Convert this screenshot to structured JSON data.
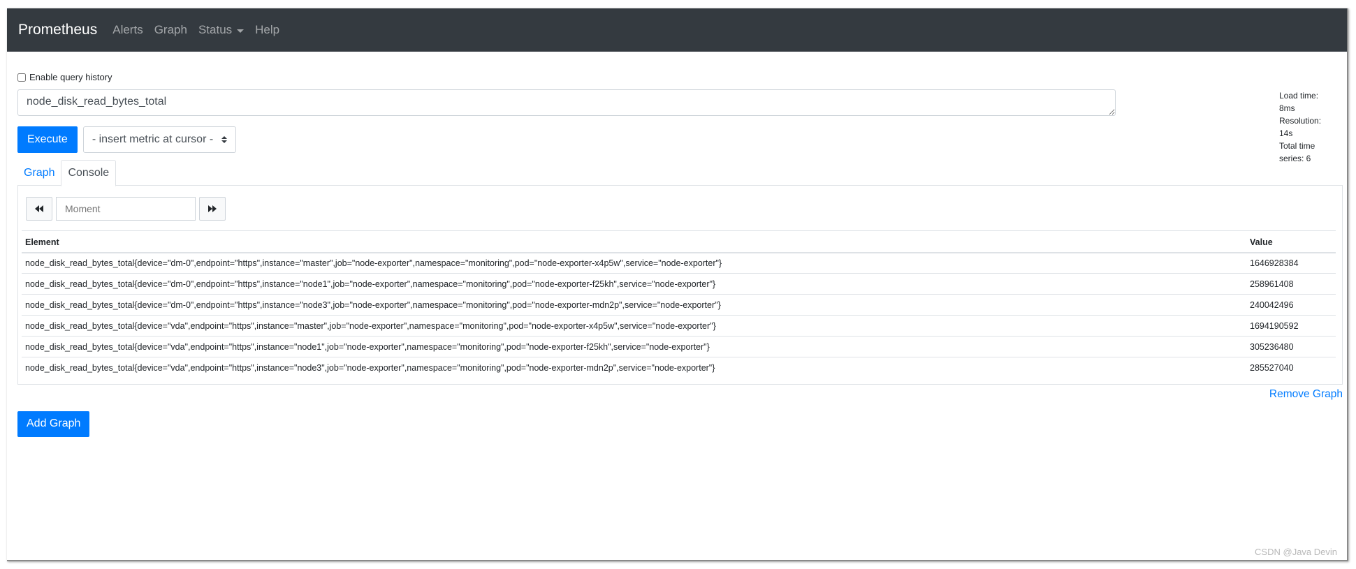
{
  "navbar": {
    "brand": "Prometheus",
    "items": [
      "Alerts",
      "Graph",
      "Status",
      "Help"
    ]
  },
  "history": {
    "label": "Enable query history",
    "checked": false
  },
  "query": {
    "value": "node_disk_read_bytes_total"
  },
  "stats": {
    "load_time": "Load time: 8ms",
    "resolution": "Resolution: 14s",
    "total_series": "Total time series: 6"
  },
  "execute_label": "Execute",
  "insert_metric": "- insert metric at cursor -",
  "tabs": [
    {
      "label": "Graph",
      "active": false
    },
    {
      "label": "Console",
      "active": true
    }
  ],
  "moment": {
    "placeholder": "Moment"
  },
  "table": {
    "headers": {
      "element": "Element",
      "value": "Value"
    },
    "rows": [
      {
        "element": "node_disk_read_bytes_total{device=\"dm-0\",endpoint=\"https\",instance=\"master\",job=\"node-exporter\",namespace=\"monitoring\",pod=\"node-exporter-x4p5w\",service=\"node-exporter\"}",
        "value": "1646928384"
      },
      {
        "element": "node_disk_read_bytes_total{device=\"dm-0\",endpoint=\"https\",instance=\"node1\",job=\"node-exporter\",namespace=\"monitoring\",pod=\"node-exporter-f25kh\",service=\"node-exporter\"}",
        "value": "258961408"
      },
      {
        "element": "node_disk_read_bytes_total{device=\"dm-0\",endpoint=\"https\",instance=\"node3\",job=\"node-exporter\",namespace=\"monitoring\",pod=\"node-exporter-mdn2p\",service=\"node-exporter\"}",
        "value": "240042496"
      },
      {
        "element": "node_disk_read_bytes_total{device=\"vda\",endpoint=\"https\",instance=\"master\",job=\"node-exporter\",namespace=\"monitoring\",pod=\"node-exporter-x4p5w\",service=\"node-exporter\"}",
        "value": "1694190592"
      },
      {
        "element": "node_disk_read_bytes_total{device=\"vda\",endpoint=\"https\",instance=\"node1\",job=\"node-exporter\",namespace=\"monitoring\",pod=\"node-exporter-f25kh\",service=\"node-exporter\"}",
        "value": "305236480"
      },
      {
        "element": "node_disk_read_bytes_total{device=\"vda\",endpoint=\"https\",instance=\"node3\",job=\"node-exporter\",namespace=\"monitoring\",pod=\"node-exporter-mdn2p\",service=\"node-exporter\"}",
        "value": "285527040"
      }
    ]
  },
  "remove_graph": "Remove Graph",
  "add_graph": "Add Graph",
  "watermark": "CSDN @Java Devin",
  "colors": {
    "navbar": "#343a40",
    "primary": "#007bff"
  }
}
